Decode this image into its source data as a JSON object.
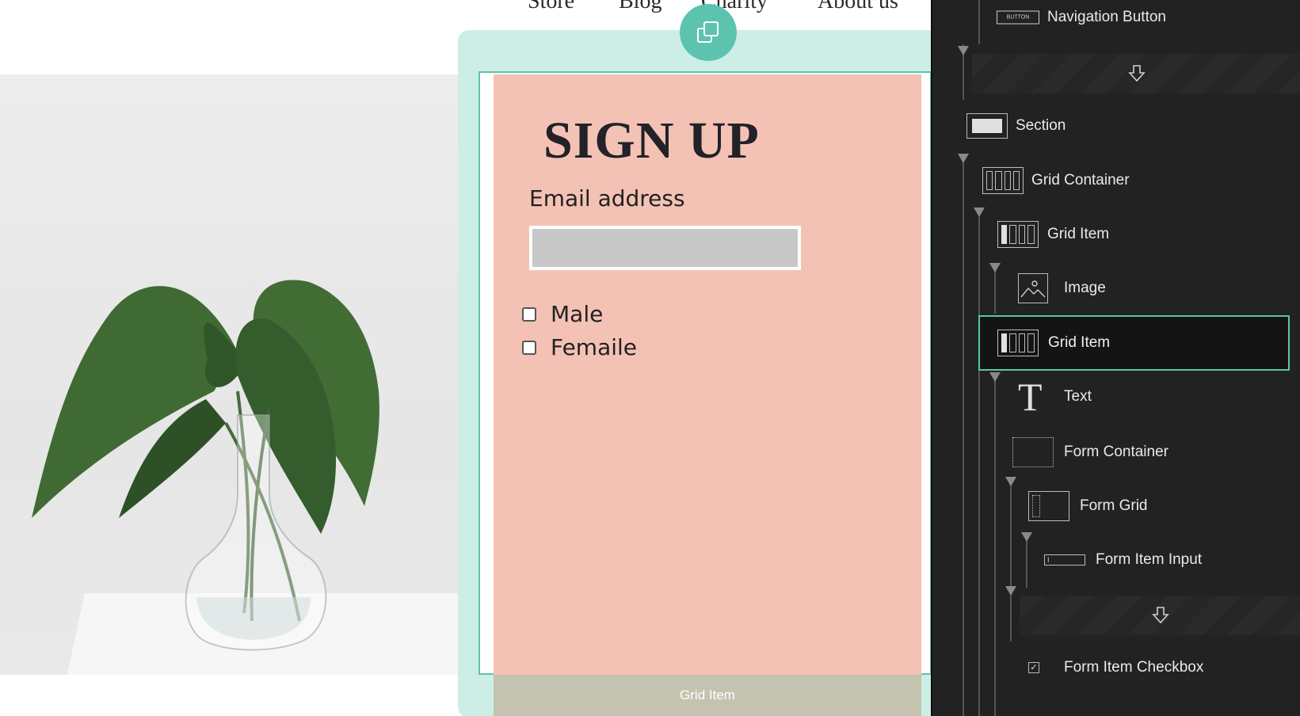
{
  "site": {
    "nav": [
      "Store",
      "Blog",
      "Charity",
      "About us"
    ]
  },
  "form": {
    "title": "SIGN UP",
    "email_label": "Email address",
    "email_value": "",
    "checkboxes": [
      {
        "label": "Male",
        "checked": false
      },
      {
        "label": "Femaile",
        "checked": false
      }
    ],
    "footer_label": "Grid Item"
  },
  "duplicate_button": {
    "icon": "duplicate-icon"
  },
  "navigator": {
    "items": [
      {
        "label": "Navigation Button",
        "icon": "button-icon"
      },
      {
        "label": "Section",
        "icon": "section-icon"
      },
      {
        "label": "Grid Container",
        "icon": "grid-container-icon"
      },
      {
        "label": "Grid Item",
        "icon": "grid-item-icon"
      },
      {
        "label": "Image",
        "icon": "image-icon"
      },
      {
        "label": "Grid Item",
        "icon": "grid-item-icon",
        "selected": true
      },
      {
        "label": "Text",
        "icon": "text-icon"
      },
      {
        "label": "Form Container",
        "icon": "form-container-icon"
      },
      {
        "label": "Form Grid",
        "icon": "form-grid-icon"
      },
      {
        "label": "Form Item Input",
        "icon": "form-input-icon"
      },
      {
        "label": "Form Item Checkbox",
        "icon": "checkbox-icon"
      }
    ],
    "button_icon_text": "BUTTON",
    "input_icon_text": "I"
  },
  "colors": {
    "accent": "#5cc3af",
    "form_bg": "#f4c2b4",
    "panel_bg": "#222222"
  }
}
